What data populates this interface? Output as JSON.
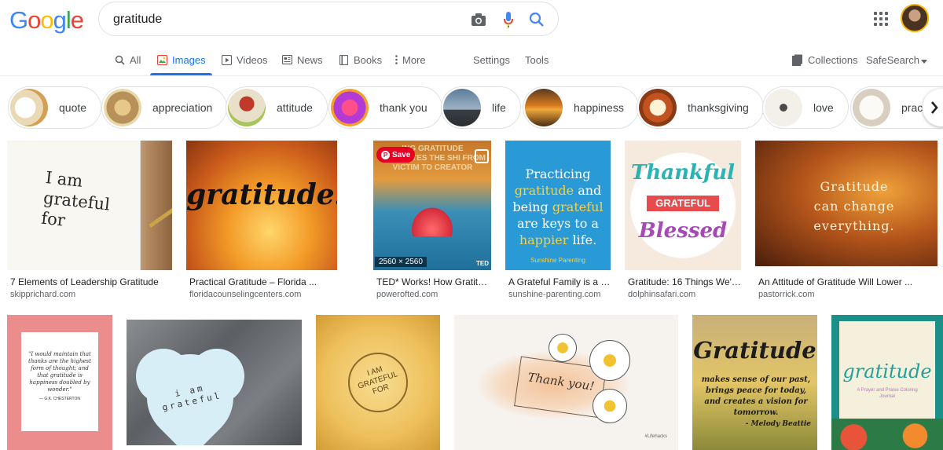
{
  "logo": {
    "letters": [
      "G",
      "o",
      "o",
      "g",
      "l",
      "e"
    ],
    "colors": [
      "#4285f4",
      "#ea4335",
      "#fbbc05",
      "#4285f4",
      "#34a853",
      "#ea4335"
    ]
  },
  "search": {
    "query": "gratitude",
    "camera_icon": "camera-icon",
    "mic_icon": "mic-icon",
    "search_icon": "search-icon"
  },
  "tabs": [
    {
      "label": "All",
      "icon": "search-icon"
    },
    {
      "label": "Images",
      "icon": "image-icon"
    },
    {
      "label": "Videos",
      "icon": "video-icon"
    },
    {
      "label": "News",
      "icon": "news-icon"
    },
    {
      "label": "Books",
      "icon": "book-icon"
    },
    {
      "label": "More",
      "icon": "more-vert-icon"
    }
  ],
  "tools": {
    "settings": "Settings",
    "tools": "Tools",
    "collections": "Collections",
    "safesearch": "SafeSearch"
  },
  "chips": [
    "quote",
    "appreciation",
    "attitude",
    "thank you",
    "life",
    "happiness",
    "thanksgiving",
    "love",
    "practice"
  ],
  "row1": [
    {
      "title": "7 Elements of Leadership Gratitude",
      "source": "skipprichard.com",
      "text": "I am grateful for"
    },
    {
      "title": "Practical Gratitude – Florida ...",
      "source": "floridacounselingcenters.com",
      "text": "gratitude:"
    },
    {
      "title": "TED* Works! How Gratitud...",
      "source": "powerofted.com",
      "text": "ING GRATITUDE CULTIVATES THE SHI FROM VICTIM TO CREATOR",
      "save": "Save",
      "dims": "2560 × 2560",
      "badge": "TED"
    },
    {
      "title": "A Grateful Family is a H...",
      "source": "sunshine-parenting.com",
      "text_parts": [
        "Practicing",
        "gratitude",
        "and",
        "being",
        "grateful",
        "are keys to a",
        "happier",
        "life."
      ],
      "brand": "Sunshine Parenting"
    },
    {
      "title": "Gratitude: 16 Things We're...",
      "source": "dolphinsafari.com",
      "text_parts": [
        "Thankful",
        "GRATEFUL",
        "Blessed"
      ]
    },
    {
      "title": "An Attitude of Gratitude Will Lower ...",
      "source": "pastorrick.com",
      "text": "Gratitude can change everything."
    }
  ],
  "row2": [
    {
      "quote": "\"I would maintain that thanks are the highest form of thought; and that gratitude is happiness doubled by wonder.\"",
      "author": "— G.K. CHESTERTON"
    },
    {
      "text": "i am grateful"
    },
    {
      "text": "I AM GRATEFUL FOR"
    },
    {
      "text": "Thank you!",
      "brand": "#Lifehacks"
    },
    {
      "title_text": "Gratitude",
      "text": "makes sense of our past, brings peace for today, and creates a vision for tomorrow.",
      "author": "- Melody Beattie"
    },
    {
      "text": "gratitude",
      "sub": "A Prayer and Praise Coloring Journal"
    }
  ]
}
